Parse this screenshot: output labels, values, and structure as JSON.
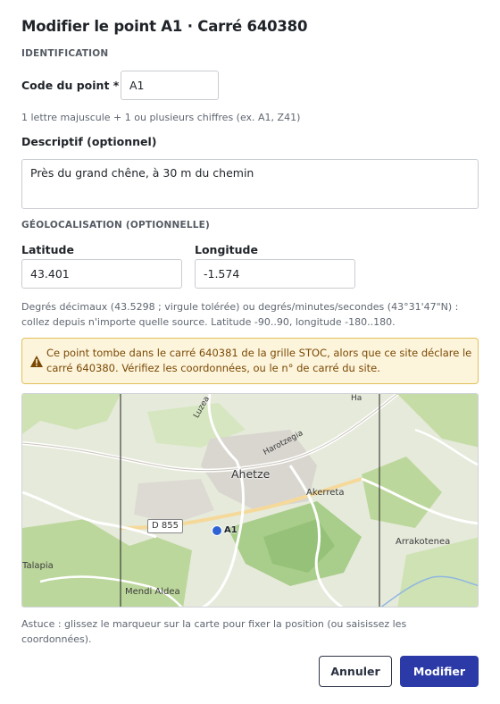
{
  "title": "Modifier le point A1 · Carré 640380",
  "identification": {
    "section_label": "IDENTIFICATION",
    "code_label": "Code du point *",
    "code_value": "A1",
    "code_help": "1 lettre majuscule + 1 ou plusieurs chiffres (ex. A1, Z41)",
    "desc_label": "Descriptif (optionnel)",
    "desc_value": "Près du grand chêne, à 30 m du chemin"
  },
  "geolocation": {
    "section_label": "GÉOLOCALISATION (OPTIONNELLE)",
    "lat_label": "Latitude",
    "lat_value": "43.401",
    "lon_label": "Longitude",
    "lon_value": "-1.574",
    "help_line1": "Degrés décimaux (43.5298 ; virgule tolérée) ou degrés/minutes/secondes (43°31'47\"N) :",
    "help_line2": "collez depuis n'importe quelle source. Latitude -90..90, longitude -180..180."
  },
  "warning": {
    "line1": "Ce point tombe dans le carré 640381 de la grille STOC, alors que ce site déclare le",
    "line2": "carré 640380. Vérifiez les coordonnées, ou le n° de carré du site.",
    "icon": "warning-triangle-icon",
    "color": "#e3bf5a"
  },
  "map": {
    "town": "Ahetze",
    "places": [
      "Akerreta",
      "Arrakotenea",
      "Mendi Aldea",
      "Talapia",
      "Harotzegia",
      "Luzea",
      "Ha"
    ],
    "road": "D 855",
    "marker_label": "A1",
    "marker_color": "#2f63d4"
  },
  "tip": {
    "line1": "Astuce : glissez le marqueur sur la carte pour fixer la position (ou saisissez les",
    "line2": "coordonnées)."
  },
  "buttons": {
    "cancel": "Annuler",
    "submit": "Modifier"
  },
  "colors": {
    "primary": "#2b3aa7",
    "warning_bg": "#fdf4dc",
    "warning_text": "#7a4a04"
  }
}
